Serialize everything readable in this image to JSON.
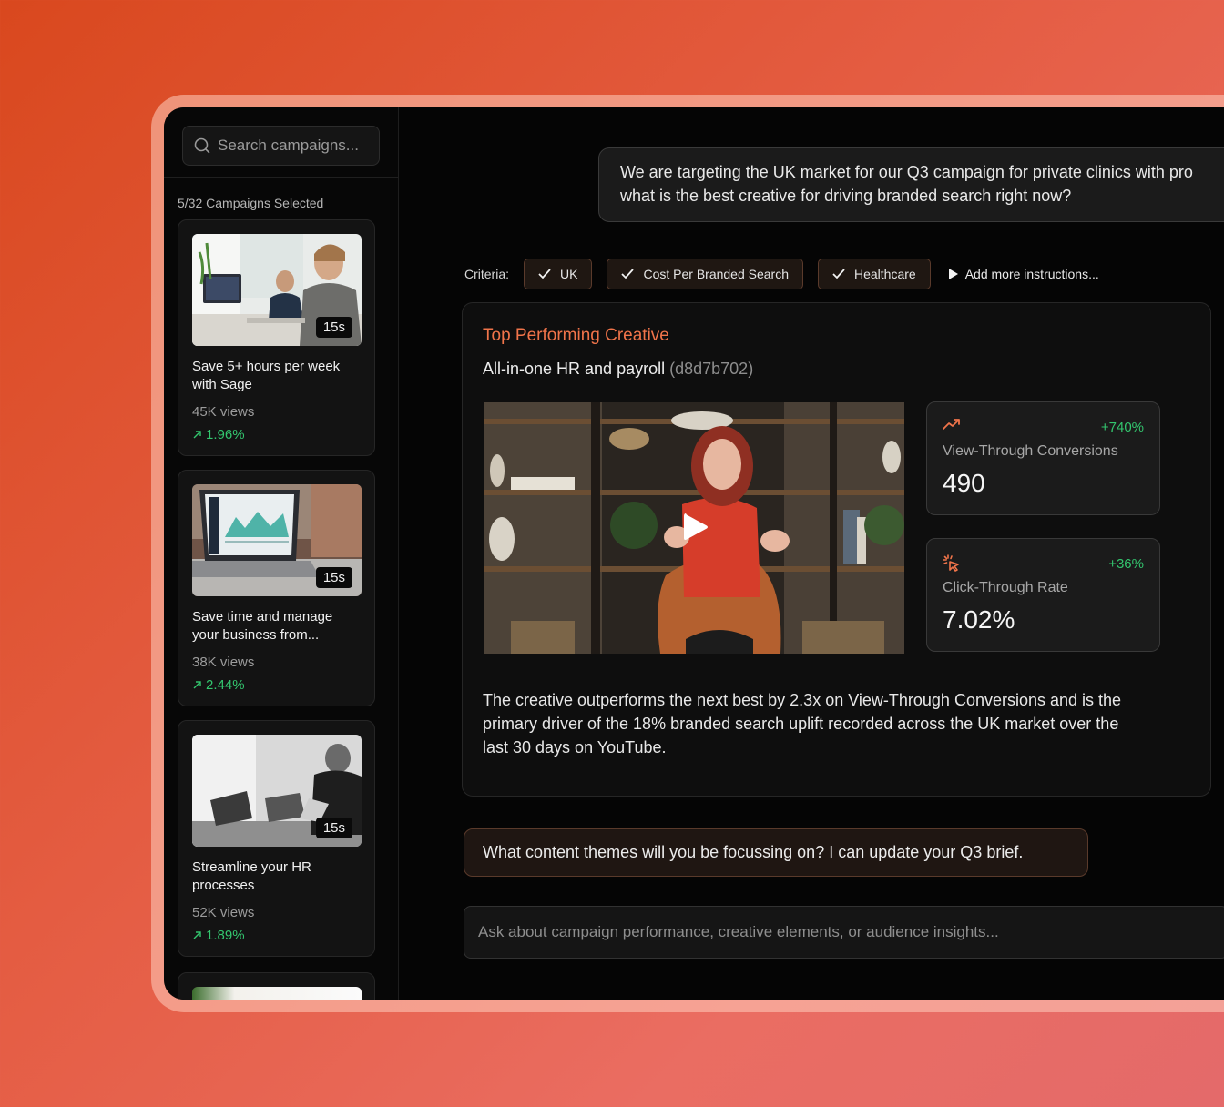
{
  "sidebar": {
    "search_placeholder": "Search campaigns...",
    "selected_count": "5/32 Campaigns Selected",
    "campaigns": [
      {
        "duration": "15s",
        "title": "Save 5+ hours per week with Sage",
        "views": "45K views",
        "trend": "1.96%"
      },
      {
        "duration": "15s",
        "title": "Save time and manage your business from...",
        "views": "38K views",
        "trend": "2.44%"
      },
      {
        "duration": "15s",
        "title": "Streamline your HR processes",
        "views": "52K views",
        "trend": "1.89%"
      }
    ]
  },
  "chat": {
    "user_message": "We are targeting the UK market for our Q3 campaign for private clinics with pro\nwhat is the best creative for driving branded search right now?",
    "criteria": {
      "label": "Criteria:",
      "chips": [
        "UK",
        "Cost Per Branded Search",
        "Healthcare"
      ],
      "add_more": "Add more instructions..."
    },
    "result": {
      "eyebrow": "Top Performing Creative",
      "title": "All-in-one HR and payroll",
      "creative_id": "(d8d7b702)",
      "metrics": [
        {
          "icon": "trend-up-icon",
          "change": "+740%",
          "label": "View-Through Conversions",
          "value": "490"
        },
        {
          "icon": "cursor-click-icon",
          "change": "+36%",
          "label": "Click-Through Rate",
          "value": "7.02%"
        }
      ],
      "summary": "The creative outperforms the next best by 2.3x on View-Through Conversions and is the primary driver of the 18% branded search uplift recorded across the UK market over the last 30 days on YouTube."
    },
    "assistant_message": "What content themes will you be focussing on? I can update your Q3 brief.",
    "input_placeholder": "Ask about campaign performance, creative elements, or audience insights..."
  },
  "colors": {
    "accent": "#f0744a",
    "positive": "#33c56e",
    "background_start": "#d9481e",
    "background_end": "#e46a6a"
  }
}
